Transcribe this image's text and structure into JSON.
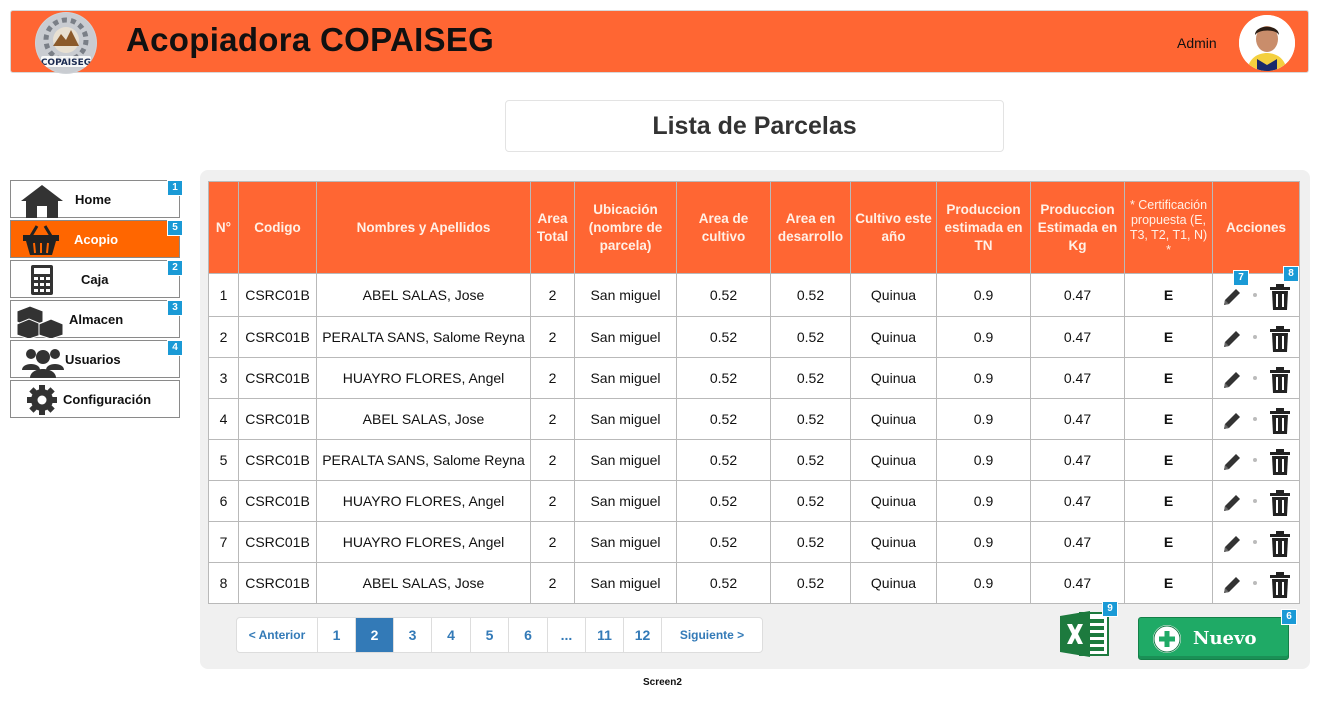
{
  "header": {
    "title": "Acopiadora COPAISEG",
    "logo_text": "COPAISEG",
    "user_label": "Admin"
  },
  "page_title": "Lista de Parcelas",
  "sidebar": {
    "items": [
      {
        "label": "Home",
        "icon": "home-icon",
        "badge": "1"
      },
      {
        "label": "Acopio",
        "icon": "basket-icon",
        "badge": "5",
        "active": true
      },
      {
        "label": "Caja",
        "icon": "calculator-icon",
        "badge": "2"
      },
      {
        "label": "Almacen",
        "icon": "boxes-icon",
        "badge": "3"
      },
      {
        "label": "Usuarios",
        "icon": "users-icon",
        "badge": "4"
      },
      {
        "label": "Configuración",
        "icon": "gear-icon",
        "badge": ""
      }
    ]
  },
  "table": {
    "headers": [
      "N°",
      "Codigo",
      "Nombres y Apellidos",
      "Area Total",
      "Ubicación (nombre de parcela)",
      "Area de cultivo",
      "Area en desarrollo",
      "Cultivo este año",
      "Produccion estimada en TN",
      "Produccion Estimada en Kg",
      "* Certificación propuesta (E, T3, T2, T1, N) *",
      "Acciones"
    ],
    "rows": [
      [
        "1",
        "CSRC01B",
        "ABEL SALAS, Jose",
        "2",
        "San miguel",
        "0.52",
        "0.52",
        "Quinua",
        "0.9",
        "0.47",
        "E"
      ],
      [
        "2",
        "CSRC01B",
        "PERALTA SANS, Salome Reyna",
        "2",
        "San miguel",
        "0.52",
        "0.52",
        "Quinua",
        "0.9",
        "0.47",
        "E"
      ],
      [
        "3",
        "CSRC01B",
        "HUAYRO FLORES, Angel",
        "2",
        "San miguel",
        "0.52",
        "0.52",
        "Quinua",
        "0.9",
        "0.47",
        "E"
      ],
      [
        "4",
        "CSRC01B",
        "ABEL SALAS, Jose",
        "2",
        "San miguel",
        "0.52",
        "0.52",
        "Quinua",
        "0.9",
        "0.47",
        "E"
      ],
      [
        "5",
        "CSRC01B",
        "PERALTA SANS, Salome Reyna",
        "2",
        "San miguel",
        "0.52",
        "0.52",
        "Quinua",
        "0.9",
        "0.47",
        "E"
      ],
      [
        "6",
        "CSRC01B",
        "HUAYRO FLORES, Angel",
        "2",
        "San miguel",
        "0.52",
        "0.52",
        "Quinua",
        "0.9",
        "0.47",
        "E"
      ],
      [
        "7",
        "CSRC01B",
        "HUAYRO FLORES, Angel",
        "2",
        "San miguel",
        "0.52",
        "0.52",
        "Quinua",
        "0.9",
        "0.47",
        "E"
      ],
      [
        "8",
        "CSRC01B",
        "ABEL SALAS, Jose",
        "2",
        "San miguel",
        "0.52",
        "0.52",
        "Quinua",
        "0.9",
        "0.47",
        "E"
      ]
    ],
    "edit_badge": "7",
    "delete_badge": "8"
  },
  "pagination": {
    "prev": "< Anterior",
    "pages": [
      "1",
      "2",
      "3",
      "4",
      "5",
      "6",
      "...",
      "11",
      "12"
    ],
    "current": "2",
    "next": "Siguiente >"
  },
  "export_badge": "9",
  "new_button": {
    "label": "Nuevo",
    "badge": "6"
  },
  "screen_label": "Screen2",
  "colors": {
    "accent": "#ff6633",
    "sidebar_active": "#ff6600",
    "badge": "#1a9ad6",
    "pager": "#337ab7",
    "new_button": "#1faa66",
    "excel": "#1d7a3e"
  }
}
